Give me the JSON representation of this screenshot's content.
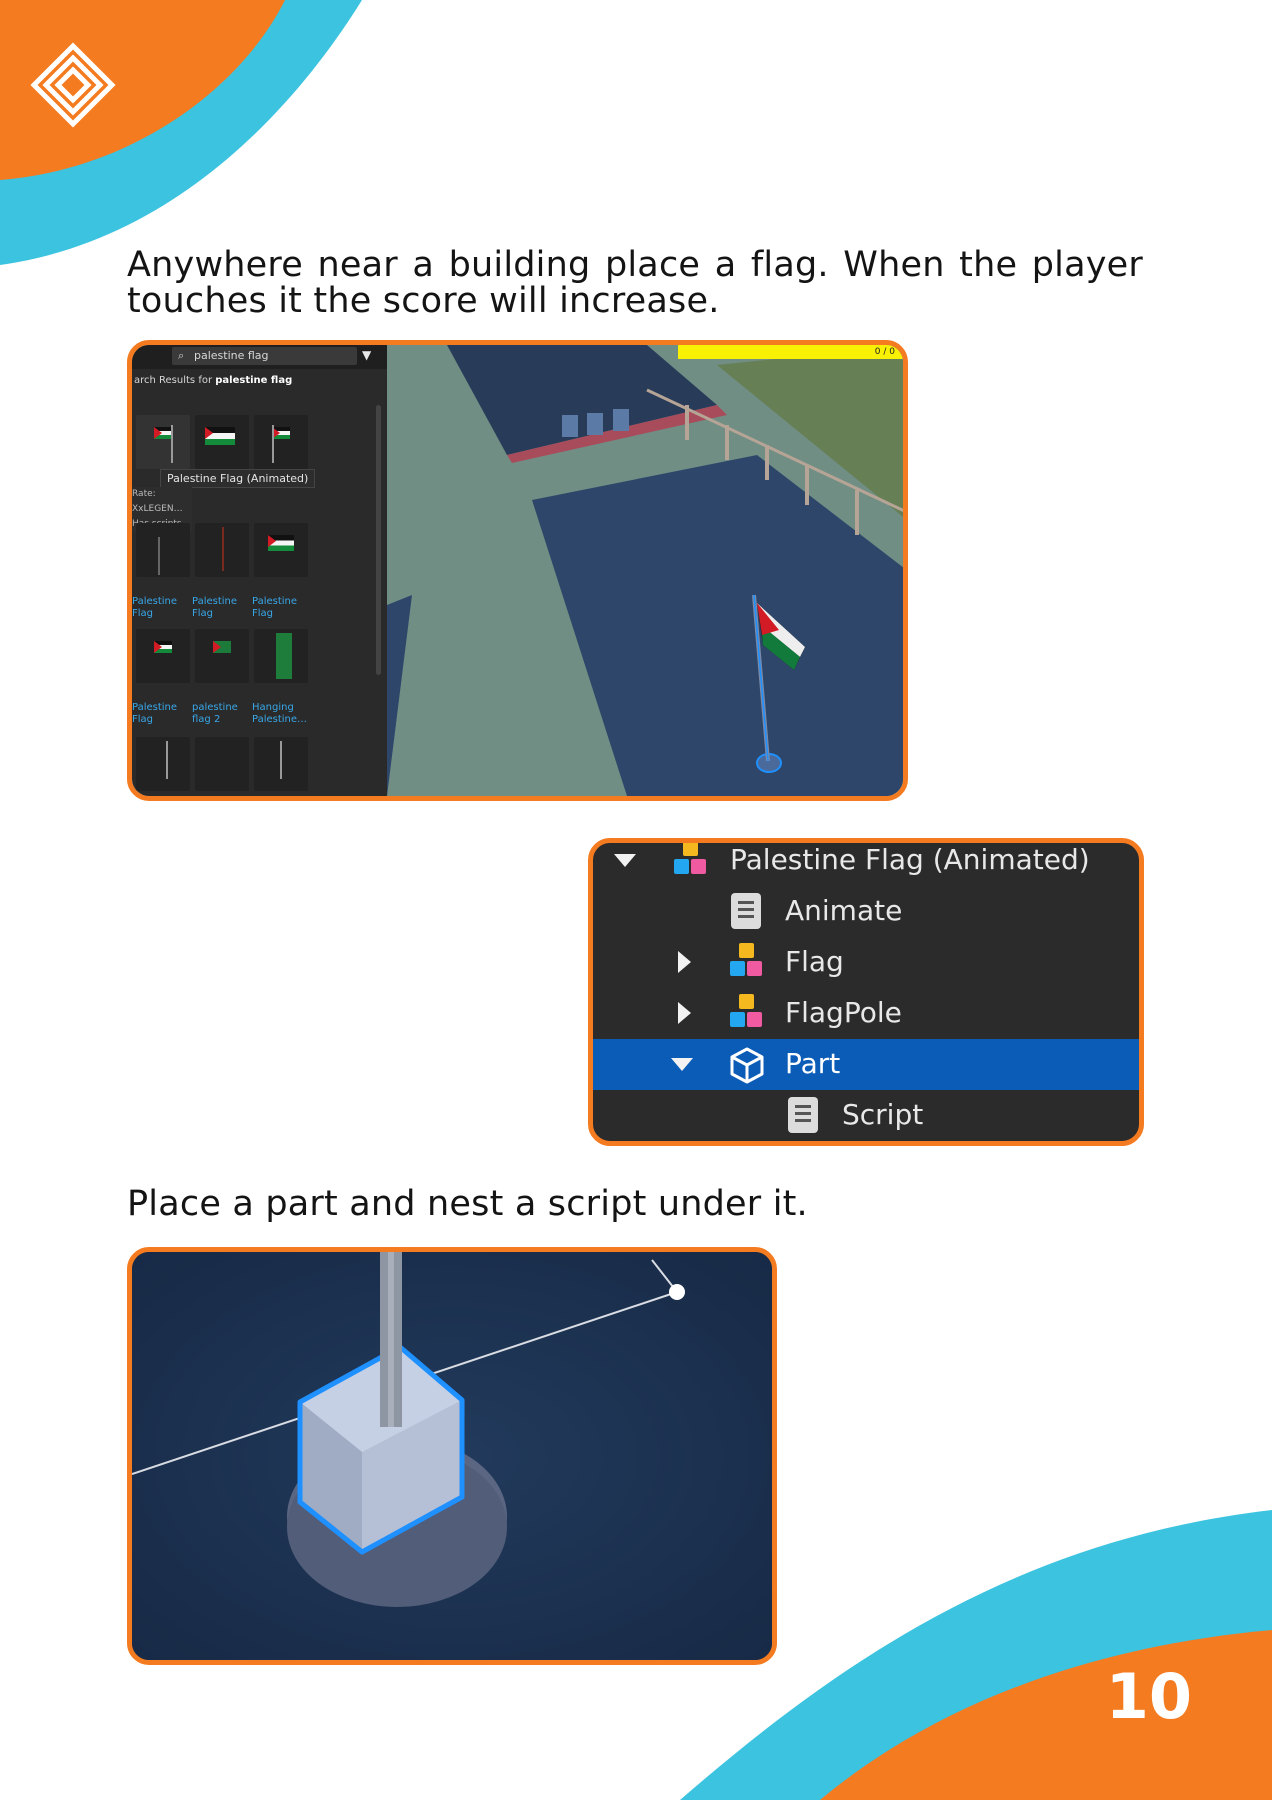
{
  "page": {
    "paragraph_1": "Anywhere near a building place a flag. When the player touches it the score will increase.",
    "paragraph_2": "Place a part and nest a script under it.",
    "page_number": "10",
    "colors": {
      "orange": "#f47b20",
      "cyan": "#3bc3e0",
      "selection_blue": "#0b5cb7"
    }
  },
  "toolbox_screenshot": {
    "search_value": "palestine flag",
    "results_prefix": "arch Results for",
    "results_query": "palestine flag",
    "tooltip": "Palestine Flag (Animated)",
    "hover_rate_label": "Rate:",
    "hover_creator": "XxLEGEN…",
    "hover_scripts": "Has scripts",
    "tile_labels": [
      "Palestine Flag",
      "Palestine Flag",
      "Palestine Flag",
      "Palestine Flag",
      "palestine flag 2",
      "Hanging Palestine…"
    ],
    "score_text": "0 / 0"
  },
  "explorer": {
    "items": [
      {
        "label": "Palestine Flag (Animated)",
        "icon": "model-icon",
        "expanded": true
      },
      {
        "label": "Animate",
        "icon": "script-icon"
      },
      {
        "label": "Flag",
        "icon": "model-icon",
        "expanded": false
      },
      {
        "label": "FlagPole",
        "icon": "model-icon",
        "expanded": false
      },
      {
        "label": "Part",
        "icon": "part-cube-icon",
        "expanded": true,
        "selected": true
      },
      {
        "label": "Script",
        "icon": "script-icon"
      }
    ]
  }
}
